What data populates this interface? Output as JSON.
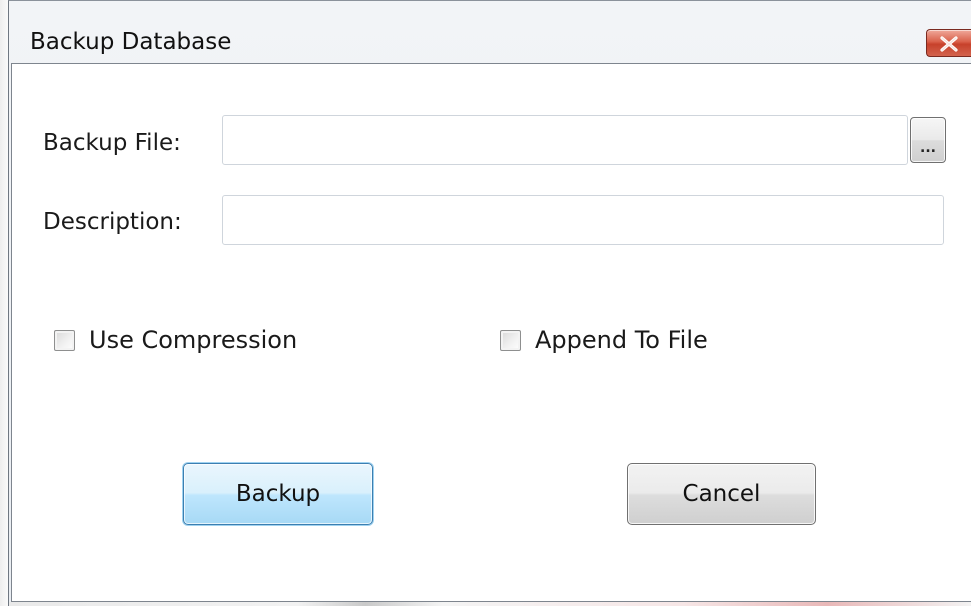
{
  "window": {
    "title": "Backup Database",
    "close_icon": "close-x-icon"
  },
  "form": {
    "backup_file_label": "Backup File:",
    "backup_file_value": "",
    "browse_label": "...",
    "description_label": "Description:",
    "description_value": ""
  },
  "options": {
    "use_compression_label": "Use Compression",
    "use_compression_checked": false,
    "append_to_file_label": "Append To File",
    "append_to_file_checked": false
  },
  "actions": {
    "backup_label": "Backup",
    "cancel_label": "Cancel"
  },
  "colors": {
    "close_button": "#c7412b",
    "default_button_border": "#3c7fb1",
    "default_button_fill": "#bee6fd"
  }
}
